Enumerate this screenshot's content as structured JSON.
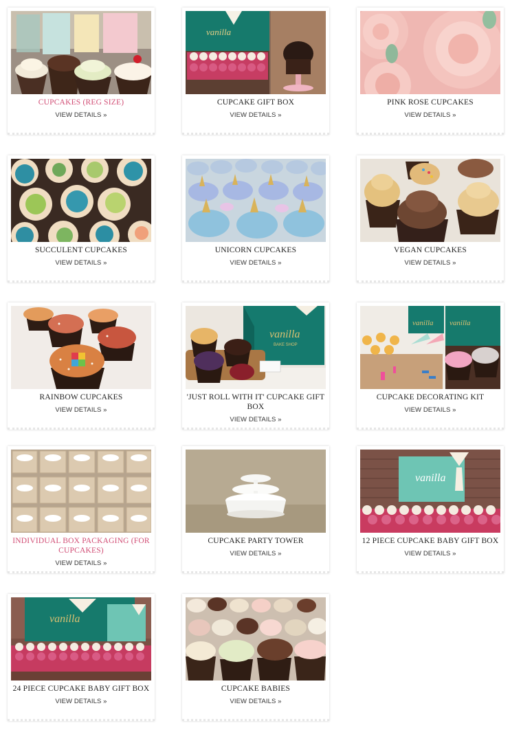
{
  "products": [
    {
      "name": "CUPCAKES (REG SIZE)",
      "link": "VIEW DETAILS »",
      "highlight": true
    },
    {
      "name": "CUPCAKE GIFT BOX",
      "link": "VIEW DETAILS »"
    },
    {
      "name": "PINK ROSE CUPCAKES",
      "link": "VIEW DETAILS »"
    },
    {
      "name": "SUCCULENT CUPCAKES",
      "link": "VIEW DETAILS »"
    },
    {
      "name": "UNICORN CUPCAKES",
      "link": "VIEW DETAILS »"
    },
    {
      "name": "VEGAN CUPCAKES",
      "link": "VIEW DETAILS »"
    },
    {
      "name": "RAINBOW CUPCAKES",
      "link": "VIEW DETAILS »"
    },
    {
      "name": "'JUST ROLL WITH IT' CUPCAKE GIFT BOX",
      "link": "VIEW DETAILS »"
    },
    {
      "name": "CUPCAKE DECORATING KIT",
      "link": "VIEW DETAILS »"
    },
    {
      "name": "INDIVIDUAL BOX PACKAGING (FOR CUPCAKES)",
      "link": "VIEW DETAILS »",
      "highlight": true
    },
    {
      "name": "CUPCAKE PARTY TOWER",
      "link": "VIEW DETAILS »"
    },
    {
      "name": "12 PIECE CUPCAKE BABY GIFT BOX",
      "link": "VIEW DETAILS »"
    },
    {
      "name": "24 PIECE CUPCAKE BABY GIFT BOX",
      "link": "VIEW DETAILS »"
    },
    {
      "name": "CUPCAKE BABIES",
      "link": "VIEW DETAILS »"
    }
  ],
  "colors": {
    "highlight_title": "#d14c74",
    "brand_teal": "#157a6e"
  }
}
